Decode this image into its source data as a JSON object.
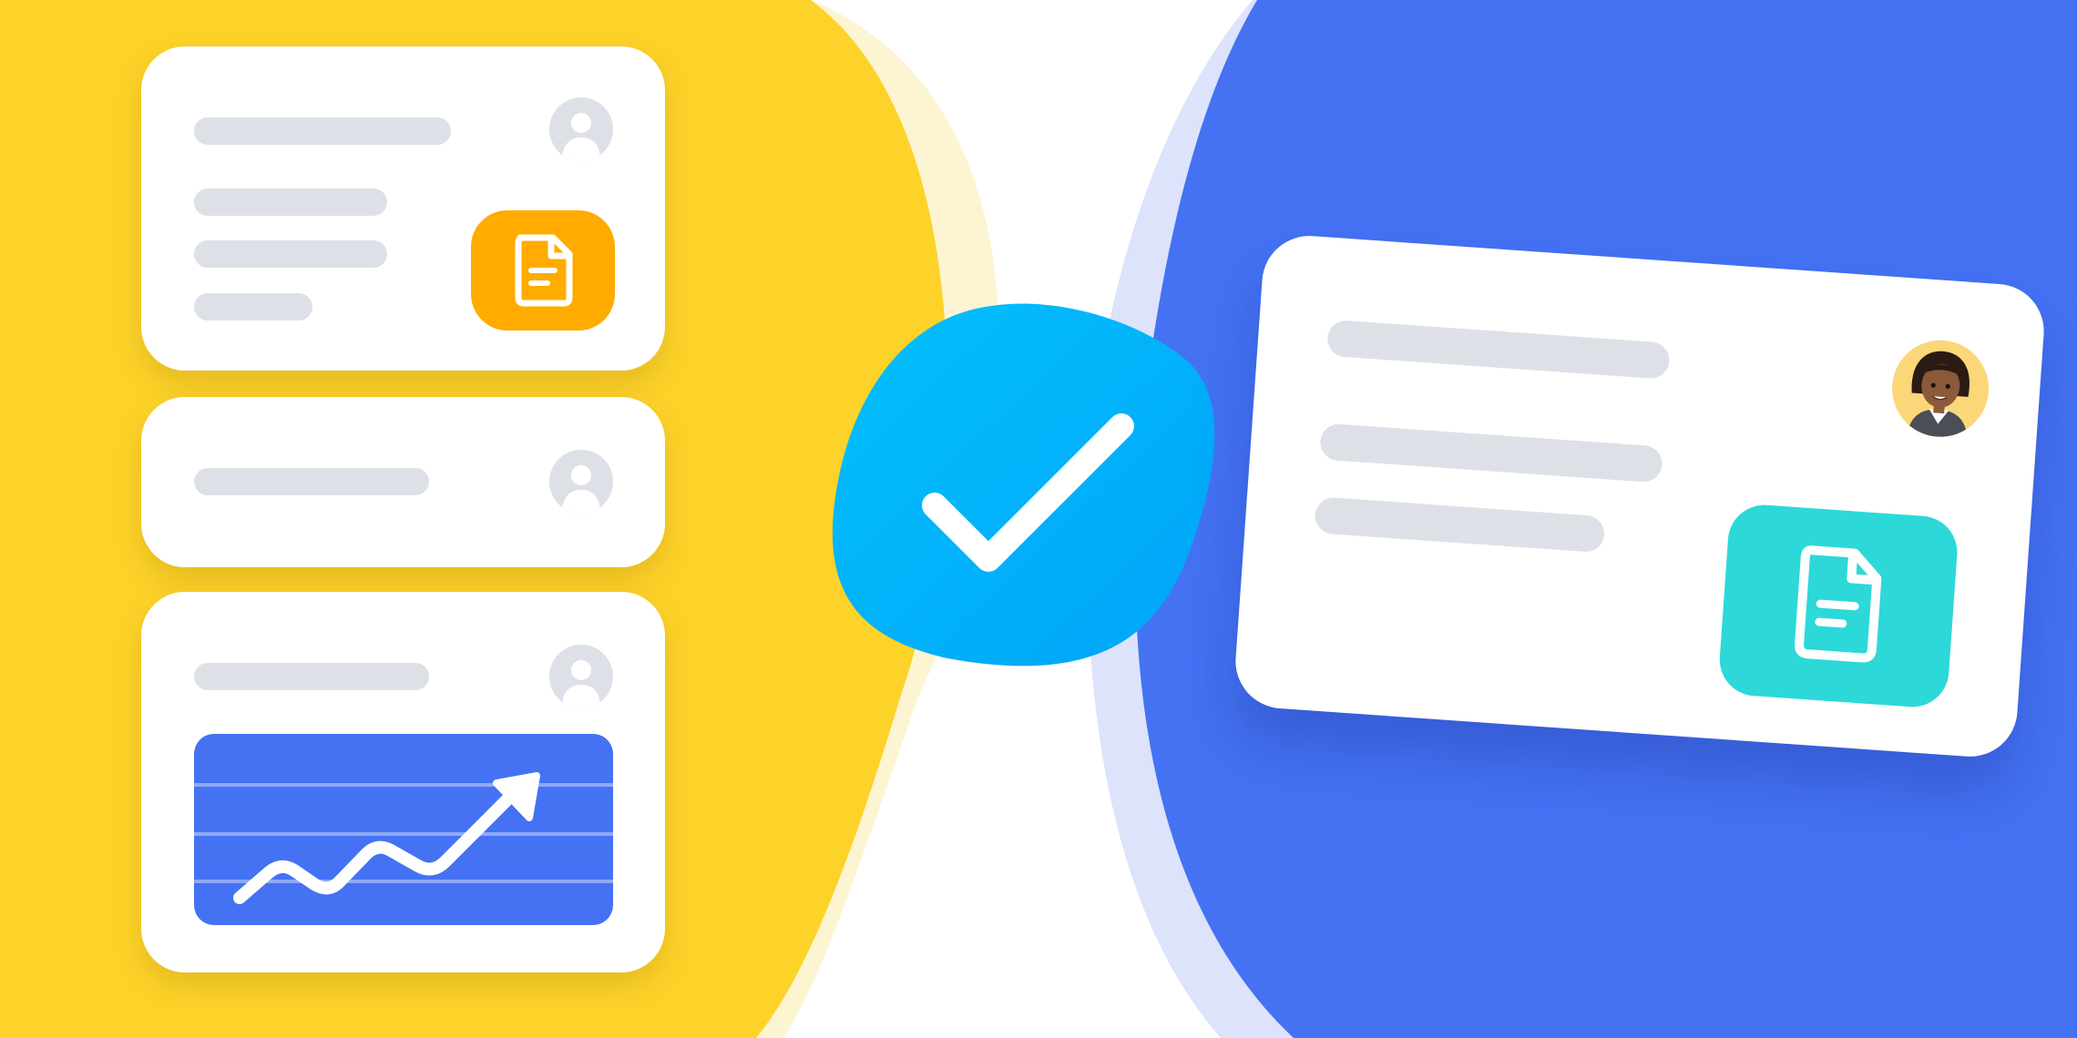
{
  "colors": {
    "left_background": "#fdd329",
    "right_background": "#4472f3",
    "check_badge": "#00b0fb",
    "orange_tile": "#ffab00",
    "teal_tile": "#2dd8d8",
    "placeholder_bar": "#dde1e7"
  },
  "scene": {
    "left_cards": [
      {
        "name": "document-card",
        "icon": "document-icon",
        "avatar": "user-placeholder-icon"
      },
      {
        "name": "compact-card",
        "avatar": "user-placeholder-icon"
      },
      {
        "name": "chart-card",
        "icon": "trending-up-chart-icon",
        "avatar": "user-placeholder-icon"
      }
    ],
    "center_badge": {
      "icon": "checkmark-icon"
    },
    "right_card": {
      "name": "profile-id-card",
      "photo": "woman-avatar-icon",
      "icon": "document-icon"
    }
  }
}
